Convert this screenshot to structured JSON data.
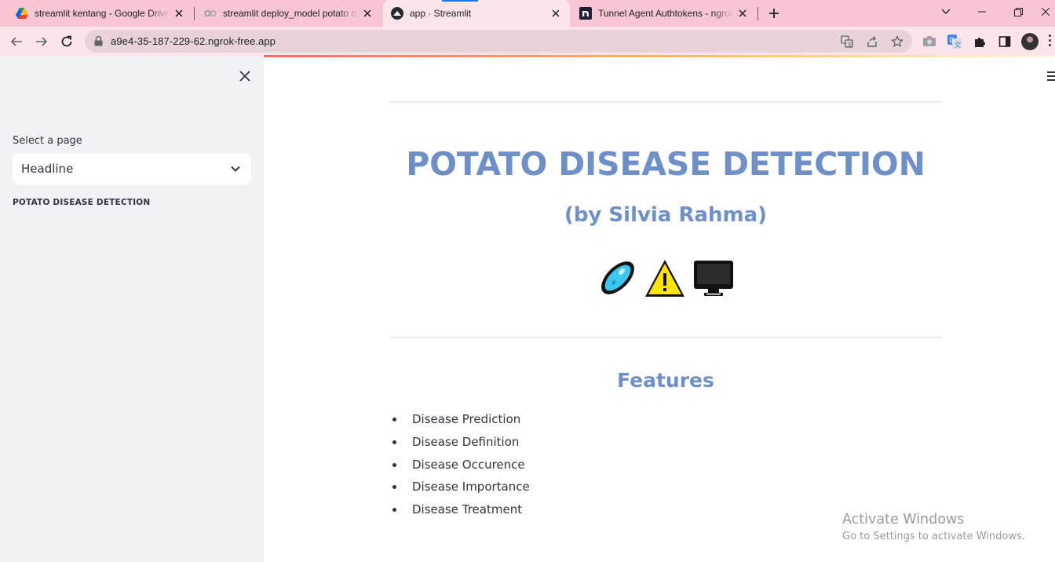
{
  "browser": {
    "tabs": [
      {
        "title": "streamlit kentang - Google Drive",
        "favicon": "google-drive-icon"
      },
      {
        "title": "streamlit deploy_model potato disease",
        "favicon": "colab-icon"
      },
      {
        "title": "app · Streamlit",
        "favicon": "streamlit-icon",
        "active": true
      },
      {
        "title": "Tunnel Agent Authtokens - ngrok",
        "favicon": "ngrok-icon"
      }
    ],
    "url": "a9e4-35-187-229-62.ngrok-free.app",
    "colors": {
      "tabstrip": "#f7c6d2",
      "toolbar": "#fbe4ea",
      "accent": "#1a73e8"
    }
  },
  "sidebar": {
    "select_label": "Select a page",
    "select_value": "Headline",
    "heading": "POTATO DISEASE DETECTION"
  },
  "main": {
    "title": "POTATO DISEASE DETECTION",
    "subtitle": "(by Silvia Rahma)",
    "emojis": [
      "microbe-icon",
      "warning-icon",
      "monitor-icon"
    ],
    "features_heading": "Features",
    "features": [
      "Disease Prediction",
      "Disease Definition",
      "Disease Occurence",
      "Disease Importance",
      "Disease Treatment"
    ],
    "colors": {
      "heading": "#6f8fc9",
      "text": "#31333f",
      "sidebar_bg": "#f0f2f6"
    }
  },
  "watermark": {
    "line1": "Activate Windows",
    "line2": "Go to Settings to activate Windows."
  }
}
